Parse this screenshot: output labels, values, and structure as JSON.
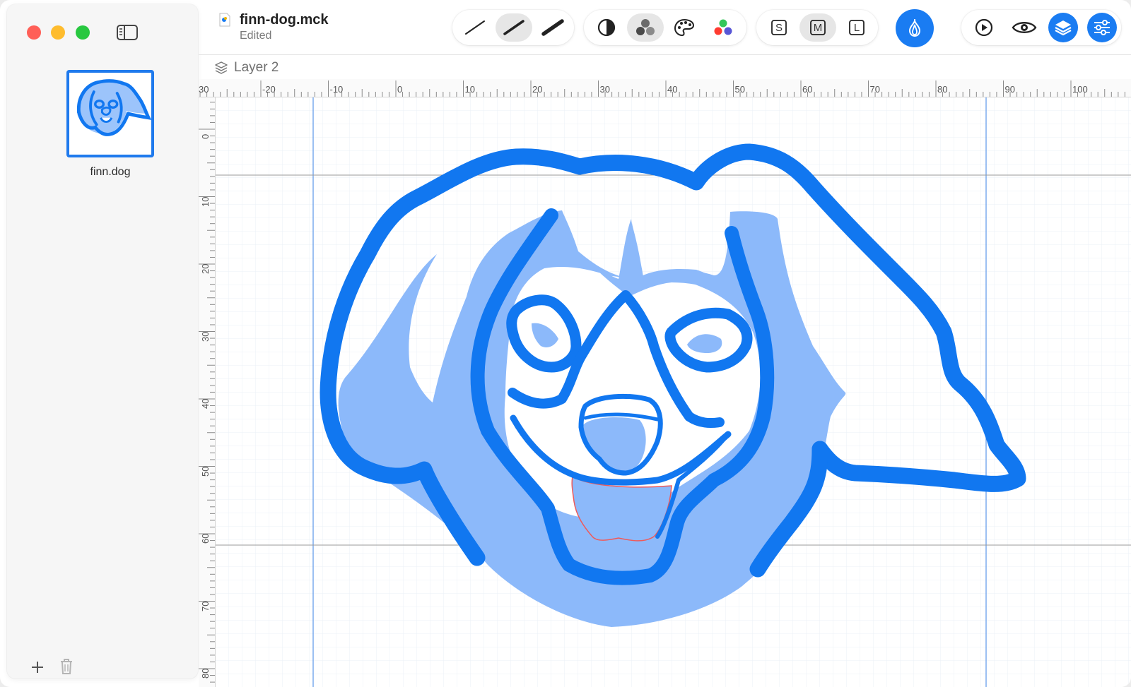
{
  "window": {
    "document_title": "finn-dog.mck",
    "document_status": "Edited"
  },
  "sidebar": {
    "thumbnail_label": "finn.dog"
  },
  "layer_bar": {
    "layer_name": "Layer 2"
  },
  "toolbar": {
    "stroke_sizes": [
      "thin",
      "medium",
      "thick"
    ],
    "selected_stroke": "medium",
    "size_buttons": [
      "S",
      "M",
      "L"
    ],
    "selected_size": "M",
    "icons": [
      "contrast-icon",
      "blend-icon",
      "palette-icon",
      "color-dots-icon",
      "onion-skin-icon",
      "play-icon",
      "eye-icon",
      "layers-icon",
      "sliders-icon"
    ]
  },
  "rulers": {
    "horizontal_labels": [
      "30",
      "-20",
      "-10",
      "0",
      "10",
      "20",
      "30",
      "40",
      "50",
      "60",
      "70",
      "80",
      "90",
      "100"
    ],
    "vertical_labels": [
      "0",
      "10",
      "20",
      "30",
      "40",
      "50",
      "60",
      "70",
      "80"
    ]
  },
  "colors": {
    "accent": "#1a7cf2",
    "stroke_blue": "#1177f0",
    "fill_light_blue": "#8cb9fa",
    "tongue_outline": "#ef5a5a",
    "guide_line": "#5a96e8",
    "grid": "#e8eef6"
  }
}
